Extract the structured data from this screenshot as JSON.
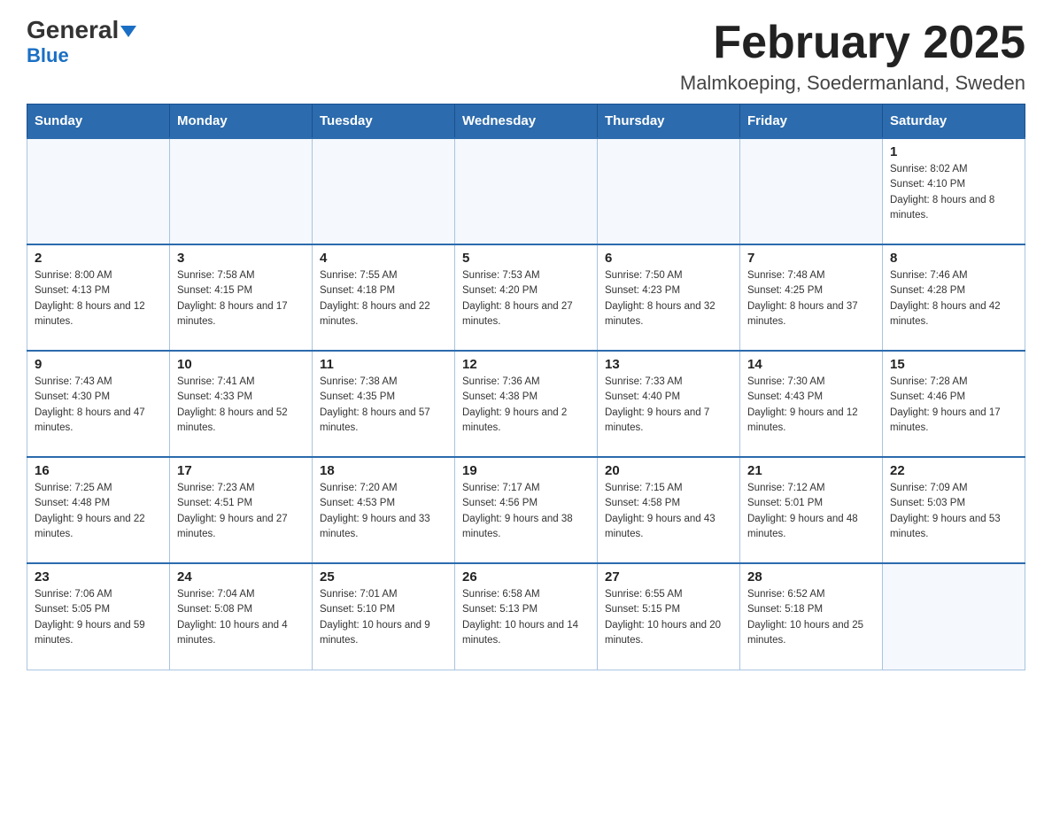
{
  "header": {
    "logo_text_general": "General",
    "logo_text_blue": "Blue",
    "title": "February 2025",
    "subtitle": "Malmkoeping, Soedermanland, Sweden"
  },
  "days_of_week": [
    "Sunday",
    "Monday",
    "Tuesday",
    "Wednesday",
    "Thursday",
    "Friday",
    "Saturday"
  ],
  "weeks": [
    [
      {
        "day": "",
        "info": ""
      },
      {
        "day": "",
        "info": ""
      },
      {
        "day": "",
        "info": ""
      },
      {
        "day": "",
        "info": ""
      },
      {
        "day": "",
        "info": ""
      },
      {
        "day": "",
        "info": ""
      },
      {
        "day": "1",
        "info": "Sunrise: 8:02 AM\nSunset: 4:10 PM\nDaylight: 8 hours and 8 minutes."
      }
    ],
    [
      {
        "day": "2",
        "info": "Sunrise: 8:00 AM\nSunset: 4:13 PM\nDaylight: 8 hours and 12 minutes."
      },
      {
        "day": "3",
        "info": "Sunrise: 7:58 AM\nSunset: 4:15 PM\nDaylight: 8 hours and 17 minutes."
      },
      {
        "day": "4",
        "info": "Sunrise: 7:55 AM\nSunset: 4:18 PM\nDaylight: 8 hours and 22 minutes."
      },
      {
        "day": "5",
        "info": "Sunrise: 7:53 AM\nSunset: 4:20 PM\nDaylight: 8 hours and 27 minutes."
      },
      {
        "day": "6",
        "info": "Sunrise: 7:50 AM\nSunset: 4:23 PM\nDaylight: 8 hours and 32 minutes."
      },
      {
        "day": "7",
        "info": "Sunrise: 7:48 AM\nSunset: 4:25 PM\nDaylight: 8 hours and 37 minutes."
      },
      {
        "day": "8",
        "info": "Sunrise: 7:46 AM\nSunset: 4:28 PM\nDaylight: 8 hours and 42 minutes."
      }
    ],
    [
      {
        "day": "9",
        "info": "Sunrise: 7:43 AM\nSunset: 4:30 PM\nDaylight: 8 hours and 47 minutes."
      },
      {
        "day": "10",
        "info": "Sunrise: 7:41 AM\nSunset: 4:33 PM\nDaylight: 8 hours and 52 minutes."
      },
      {
        "day": "11",
        "info": "Sunrise: 7:38 AM\nSunset: 4:35 PM\nDaylight: 8 hours and 57 minutes."
      },
      {
        "day": "12",
        "info": "Sunrise: 7:36 AM\nSunset: 4:38 PM\nDaylight: 9 hours and 2 minutes."
      },
      {
        "day": "13",
        "info": "Sunrise: 7:33 AM\nSunset: 4:40 PM\nDaylight: 9 hours and 7 minutes."
      },
      {
        "day": "14",
        "info": "Sunrise: 7:30 AM\nSunset: 4:43 PM\nDaylight: 9 hours and 12 minutes."
      },
      {
        "day": "15",
        "info": "Sunrise: 7:28 AM\nSunset: 4:46 PM\nDaylight: 9 hours and 17 minutes."
      }
    ],
    [
      {
        "day": "16",
        "info": "Sunrise: 7:25 AM\nSunset: 4:48 PM\nDaylight: 9 hours and 22 minutes."
      },
      {
        "day": "17",
        "info": "Sunrise: 7:23 AM\nSunset: 4:51 PM\nDaylight: 9 hours and 27 minutes."
      },
      {
        "day": "18",
        "info": "Sunrise: 7:20 AM\nSunset: 4:53 PM\nDaylight: 9 hours and 33 minutes."
      },
      {
        "day": "19",
        "info": "Sunrise: 7:17 AM\nSunset: 4:56 PM\nDaylight: 9 hours and 38 minutes."
      },
      {
        "day": "20",
        "info": "Sunrise: 7:15 AM\nSunset: 4:58 PM\nDaylight: 9 hours and 43 minutes."
      },
      {
        "day": "21",
        "info": "Sunrise: 7:12 AM\nSunset: 5:01 PM\nDaylight: 9 hours and 48 minutes."
      },
      {
        "day": "22",
        "info": "Sunrise: 7:09 AM\nSunset: 5:03 PM\nDaylight: 9 hours and 53 minutes."
      }
    ],
    [
      {
        "day": "23",
        "info": "Sunrise: 7:06 AM\nSunset: 5:05 PM\nDaylight: 9 hours and 59 minutes."
      },
      {
        "day": "24",
        "info": "Sunrise: 7:04 AM\nSunset: 5:08 PM\nDaylight: 10 hours and 4 minutes."
      },
      {
        "day": "25",
        "info": "Sunrise: 7:01 AM\nSunset: 5:10 PM\nDaylight: 10 hours and 9 minutes."
      },
      {
        "day": "26",
        "info": "Sunrise: 6:58 AM\nSunset: 5:13 PM\nDaylight: 10 hours and 14 minutes."
      },
      {
        "day": "27",
        "info": "Sunrise: 6:55 AM\nSunset: 5:15 PM\nDaylight: 10 hours and 20 minutes."
      },
      {
        "day": "28",
        "info": "Sunrise: 6:52 AM\nSunset: 5:18 PM\nDaylight: 10 hours and 25 minutes."
      },
      {
        "day": "",
        "info": ""
      }
    ]
  ]
}
